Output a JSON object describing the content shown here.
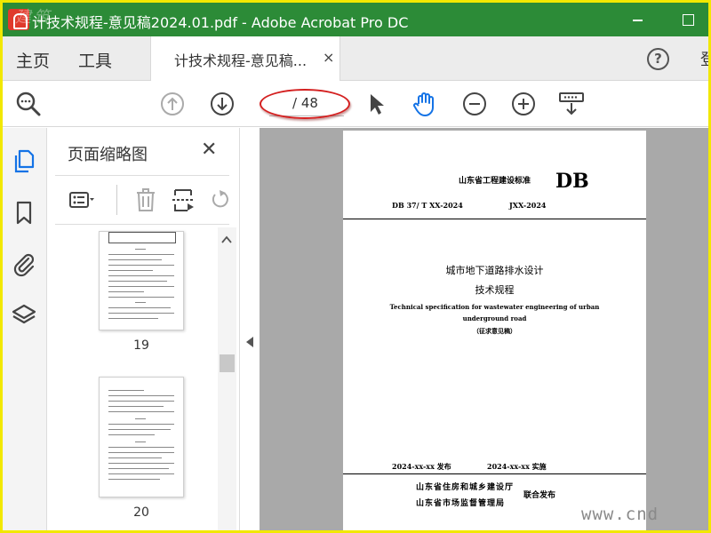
{
  "window": {
    "title": "计技术规程-意见稿2024.01.pdf - Adobe Acrobat Pro DC",
    "logo_overlay": "建筑"
  },
  "tabs": {
    "home": "主页",
    "tools": "工具",
    "document": "计技术规程-意见稿...",
    "close_glyph": "×",
    "help_glyph": "?",
    "overflow_glyph": "登"
  },
  "toolbar": {
    "page_current": "",
    "page_total": "/ 48",
    "accent_color": "#1473e6"
  },
  "thumbnail_panel": {
    "title": "页面缩略图",
    "close_glyph": "✕",
    "pages": [
      {
        "label": "19"
      },
      {
        "label": "20"
      }
    ]
  },
  "document": {
    "standard_label": "山东省工程建设标准",
    "db_mark": "DB",
    "code_left": "DB 37/ T XX-2024",
    "code_right": "JXX-2024",
    "title_line1": "城市地下道路排水设计",
    "title_line2": "技术规程",
    "title_en_line1": "Technical specification for wastewater engineering of urban",
    "title_en_line2": "underground road",
    "draft_note": "（征求意见稿）",
    "release_date": "2024-xx-xx 发布",
    "effective_date": "2024-xx-xx 实施",
    "issuer1": "山东省住房和城乡建设厅",
    "issuer2": "山东省市场监督管理局",
    "joint_release": "联合发布"
  },
  "watermark": "www.cnd"
}
